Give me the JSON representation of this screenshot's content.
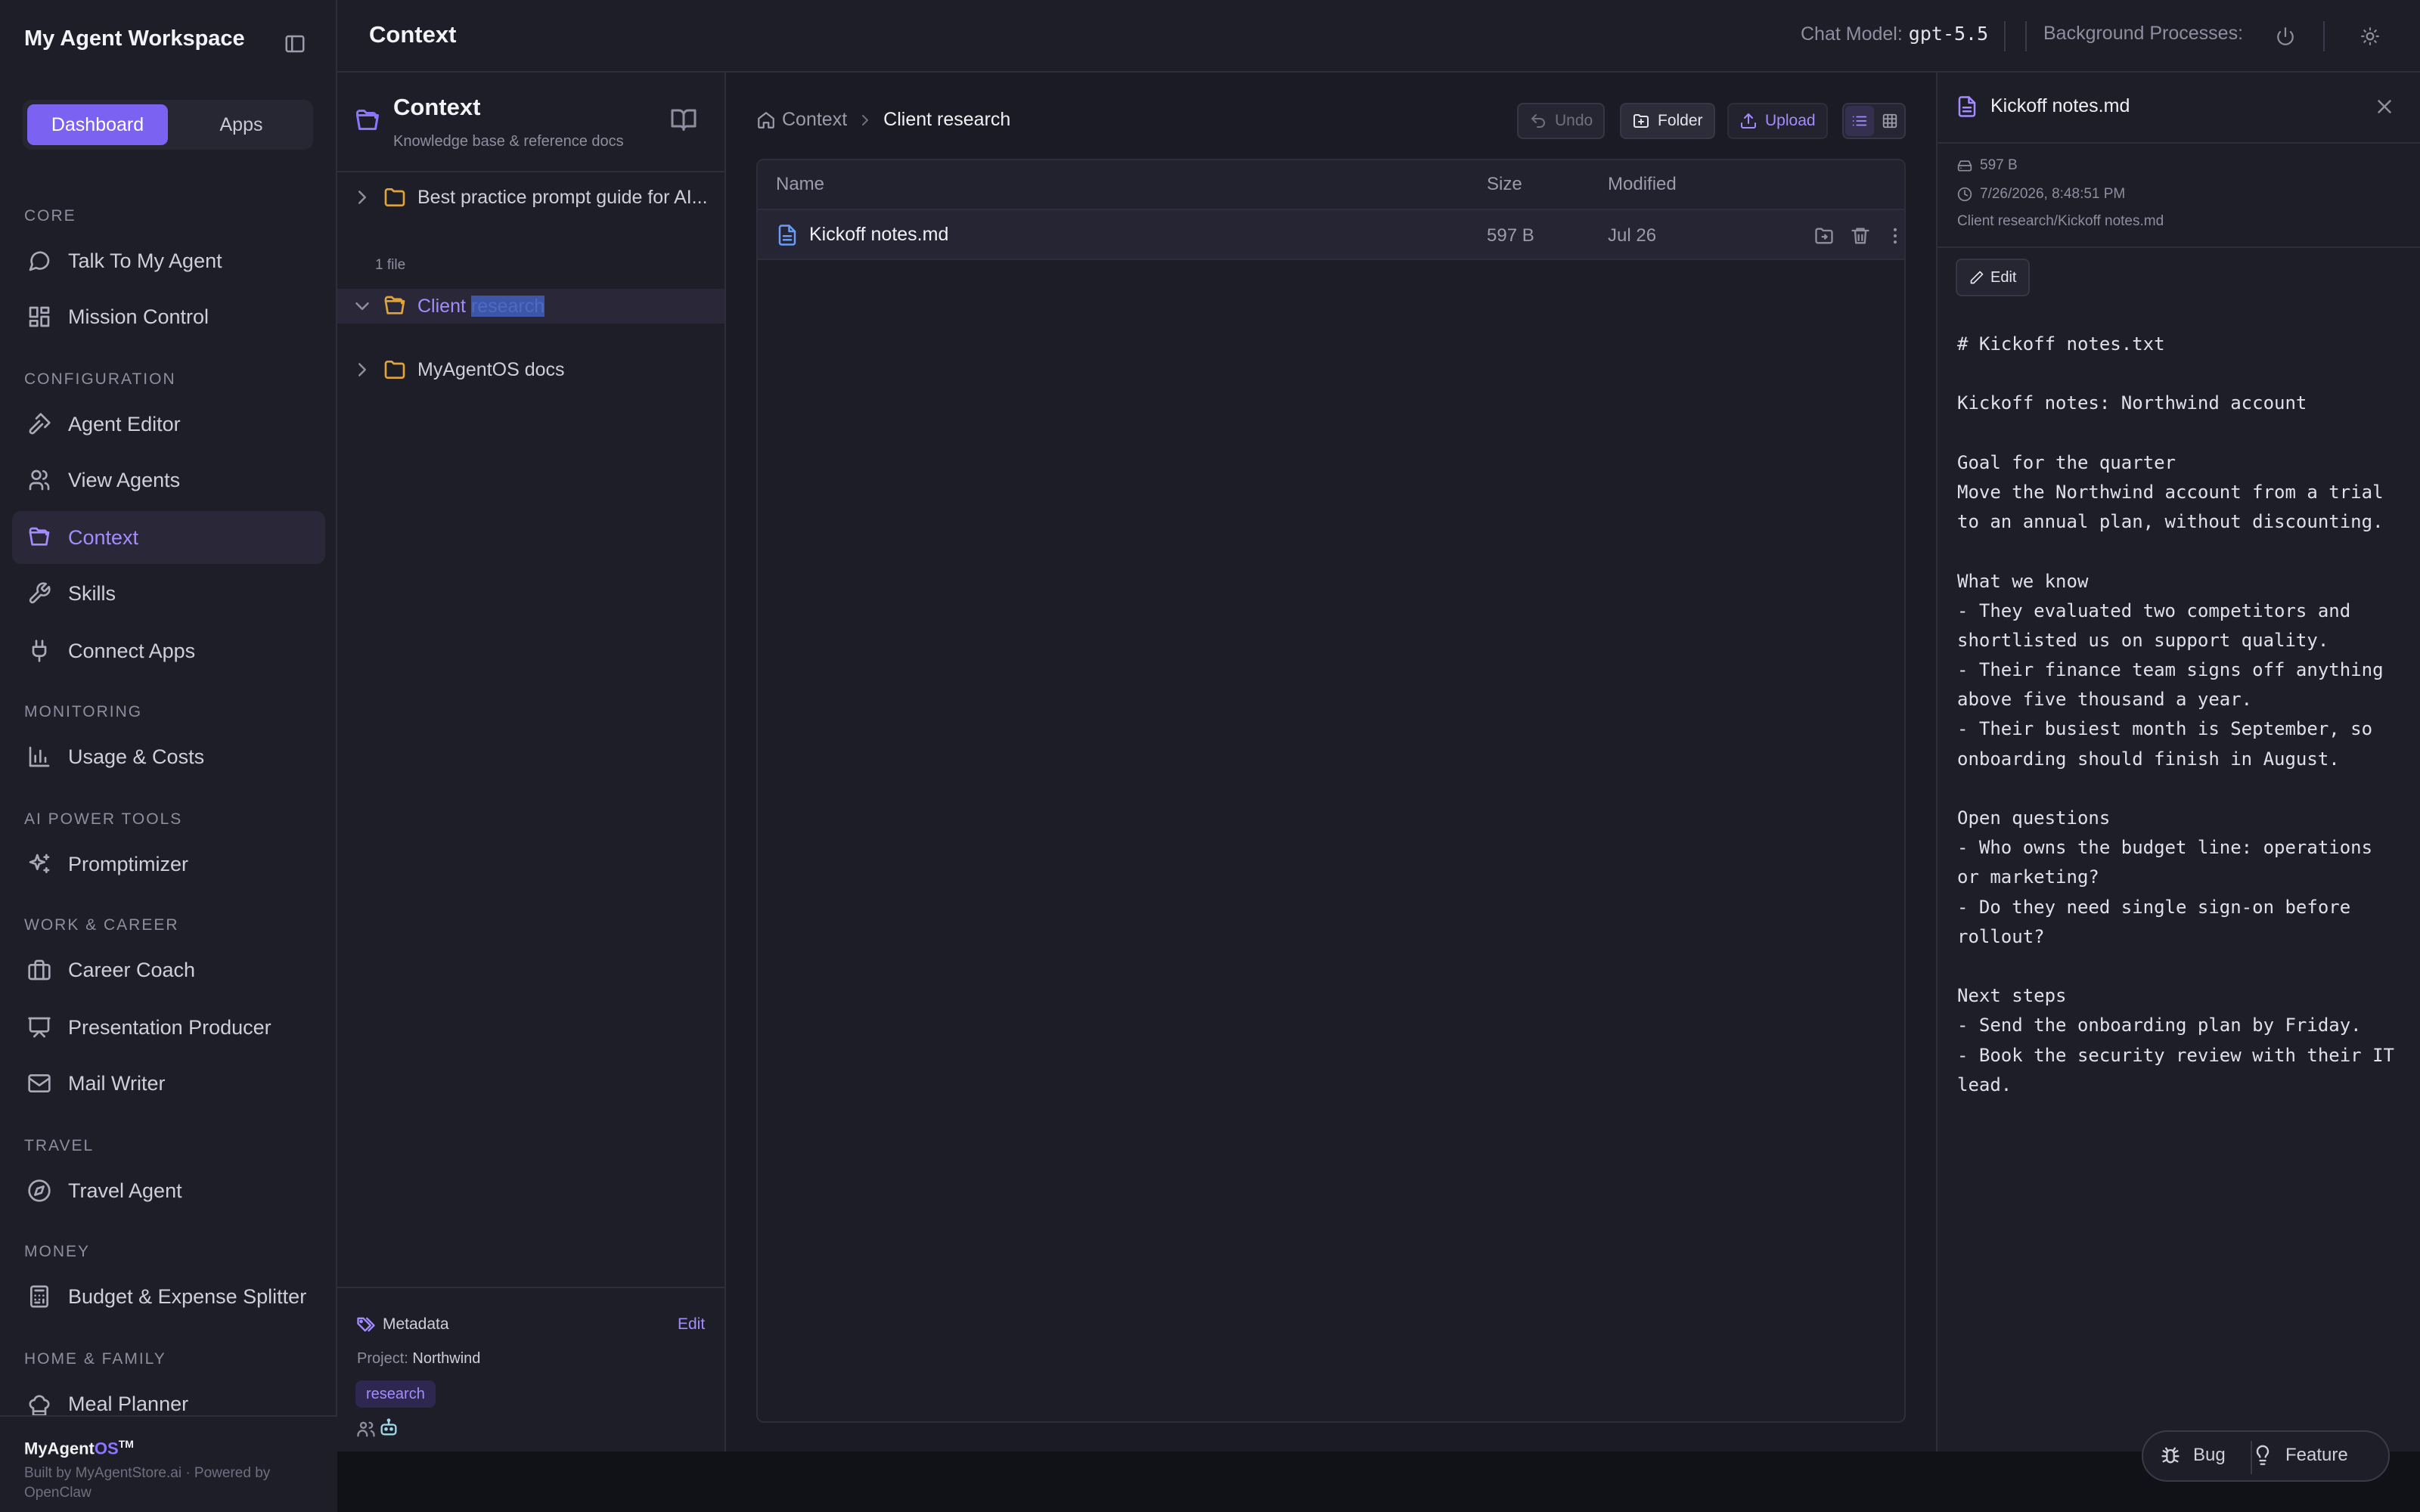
{
  "sidebar": {
    "workspace_title": "My Agent Workspace",
    "switcher": {
      "dashboard": "Dashboard",
      "apps": "Apps"
    },
    "sections": {
      "core": "CORE",
      "configuration": "CONFIGURATION",
      "monitoring": "MONITORING",
      "ai_power_tools": "AI POWER TOOLS",
      "work_career": "WORK & CAREER",
      "travel": "TRAVEL",
      "money": "MONEY",
      "home_family": "HOME & FAMILY"
    },
    "items": {
      "talk": "Talk To My Agent",
      "mission": "Mission Control",
      "agent_editor": "Agent Editor",
      "view_agents": "View Agents",
      "context": "Context",
      "skills": "Skills",
      "connect_apps": "Connect Apps",
      "usage": "Usage & Costs",
      "promptimizer": "Promptimizer",
      "career": "Career Coach",
      "presentation": "Presentation Producer",
      "mail": "Mail Writer",
      "travel_agent": "Travel Agent",
      "budget": "Budget & Expense Splitter",
      "meal": "Meal Planner"
    },
    "active_item": "Context",
    "footer": {
      "brand_prefix": "MyAgent",
      "brand_os": "OS",
      "brand_tm": "TM",
      "built_by": "Built by MyAgentStore.ai · Powered by OpenClaw"
    }
  },
  "topbar": {
    "title": "Context",
    "chat_model_label": "Chat Model:",
    "chat_model_value": "gpt-5.5",
    "background_label": "Background Processes:"
  },
  "tree": {
    "title": "Context",
    "subtitle": "Knowledge base & reference docs",
    "folders": [
      {
        "name": "Best practice prompt guide for AI..."
      },
      {
        "name_visible": "Client",
        "name_selected": "research"
      },
      {
        "name": "MyAgentOS docs"
      }
    ],
    "file_count": "1 file",
    "metadata": {
      "title": "Metadata",
      "edit": "Edit",
      "project_label": "Project:",
      "project_value": "Northwind",
      "tag": "research"
    }
  },
  "browser": {
    "breadcrumb": [
      "Context",
      "Client research"
    ],
    "buttons": {
      "undo": "Undo",
      "folder": "Folder",
      "upload": "Upload"
    },
    "columns": {
      "name": "Name",
      "size": "Size",
      "modified": "Modified"
    },
    "files": [
      {
        "name": "Kickoff notes.md",
        "size": "597 B",
        "modified": "Jul 26"
      }
    ]
  },
  "preview": {
    "title": "Kickoff notes.md",
    "size": "597 B",
    "timestamp": "7/26/2026, 8:48:51 PM",
    "path": "Client research/Kickoff notes.md",
    "edit": "Edit",
    "content_lines": [
      "# Kickoff notes.txt",
      "",
      "Kickoff notes: Northwind account",
      "",
      "Goal for the quarter",
      "Move the Northwind account from a trial",
      "to an annual plan, without discounting.",
      "",
      "What we know",
      "- They evaluated two competitors and",
      "shortlisted us on support quality.",
      "- Their finance team signs off anything",
      "above five thousand a year.",
      "- Their busiest month is September, so",
      "onboarding should finish in August.",
      "",
      "Open questions",
      "- Who owns the budget line: operations",
      "or marketing?",
      "- Do they need single sign-on before",
      "rollout?",
      "",
      "Next steps",
      "- Send the onboarding plan by Friday.",
      "- Book the security review with their IT",
      "lead."
    ]
  },
  "feedback": {
    "bug": "Bug",
    "feature": "Feature"
  },
  "colors": {
    "accent": "#8d74ff",
    "folder": "#e0a43a",
    "file": "#6a9cf5",
    "background": "#1b1b25"
  }
}
